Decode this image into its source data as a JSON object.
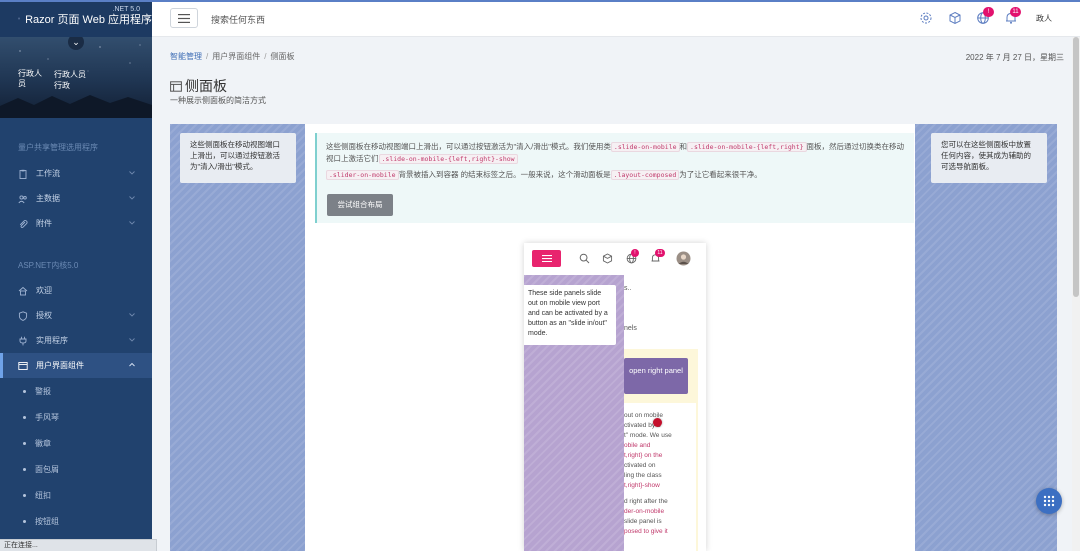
{
  "brand": {
    "title": "Razor 页面 Web 应用程序",
    "sup": ".NET 5.0"
  },
  "profile": {
    "avatar_alt": "行政人员",
    "name_line1": "行政人员",
    "name_line2": "行政"
  },
  "sidebar": {
    "group1": "量户共享管理选用程序",
    "group1_items": [
      {
        "label": "工作流"
      },
      {
        "label": "主数据"
      },
      {
        "label": "附件"
      }
    ],
    "group2": "ASP.NET内核5.0",
    "group2_items": [
      {
        "label": "欢迎"
      },
      {
        "label": "授权"
      },
      {
        "label": "实用程序"
      },
      {
        "label": "用户界面组件"
      }
    ],
    "sub_items": [
      {
        "label": "警报"
      },
      {
        "label": "手风琴"
      },
      {
        "label": "徽章"
      },
      {
        "label": "面包屑"
      },
      {
        "label": "纽扣"
      },
      {
        "label": "按钮组"
      }
    ]
  },
  "status_tip": "正在连接...",
  "header": {
    "search_placeholder": "搜索任何东西",
    "badge_globe": "!",
    "badge_bell": "11",
    "user": "政人"
  },
  "breadcrumb": {
    "items": [
      "智能管理",
      "用户界面组件",
      "侧面板"
    ]
  },
  "date": "2022 年 7 月 27 日，星期三",
  "page": {
    "title": "侧面板",
    "subtitle": "一种展示侧面板的简洁方式"
  },
  "left_card": "这些侧面板在移动视图端口上滑出，可以通过按钮激活为\"清入/滑出\"模式。",
  "right_card": "您可以在这些侧面板中放置任何内容，使其成为辅助的可选导航面板。",
  "info": {
    "t1": "这些侧面板在移动视图端口上滑出，可以通过按钮激活为\"清入/滑出\"模式。我们使用类",
    "c1": ".slide-on-mobile",
    "t2": "和",
    "c2": ".slide-on-mobile-{left,right}",
    "t3": "面板，然后通过切换类在移动视口上激活它们",
    "c3": ".slide-on-mobile-{left,right}-show",
    "c4": ".slider-on-mobile",
    "t4": "背景被插入到容器 的结束标签之后。一般来说，这个滑动面板是",
    "c5": ".layout-composed",
    "t5": "为了让它看起来很干净。",
    "button": "尝试组合布局"
  },
  "phone": {
    "badge_globe": "!",
    "badge_bell": "11",
    "ghost1": "s..",
    "ghost2": "nels",
    "open_right": "open right panel",
    "slide_card": "These side panels slide out on mobile view port and can be activated by a button as an \"slide in/out\" mode.",
    "right_lines": [
      "out on mobile",
      "ctivated by a",
      "t\" mode. We use",
      "obile  and",
      "t,right}  on the",
      "ctivated on",
      "ling the class",
      "t,right}-show",
      "",
      "d right after the",
      "der-on-mobile",
      " slide panel is",
      "posed  to give it"
    ]
  }
}
